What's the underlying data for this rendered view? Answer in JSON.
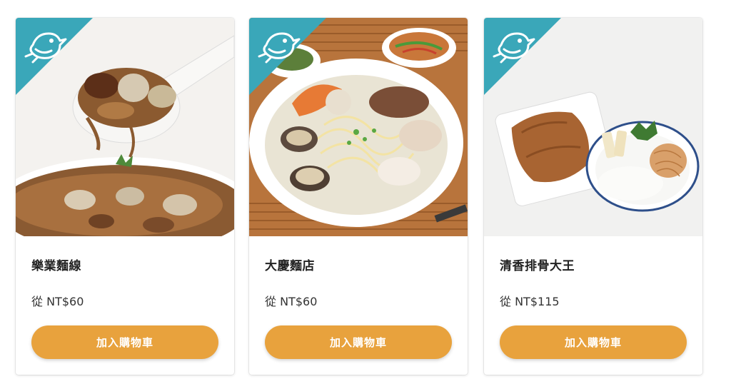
{
  "theme": {
    "badge_color": "#3aa7b9",
    "button_color": "#e8a23d"
  },
  "products": [
    {
      "name": "樂業麵線",
      "price": "從 NT$60",
      "button_label": "加入購物車",
      "badge_icon": "bird-icon",
      "photo": "oyster-vermicelli-photo"
    },
    {
      "name": "大慶麵店",
      "price": "從 NT$60",
      "button_label": "加入購物車",
      "badge_icon": "bird-icon",
      "photo": "seafood-noodle-soup-photo"
    },
    {
      "name": "清香排骨大王",
      "price": "從 NT$115",
      "button_label": "加入購物車",
      "badge_icon": "bird-icon",
      "photo": "pork-chop-rice-photo"
    }
  ]
}
